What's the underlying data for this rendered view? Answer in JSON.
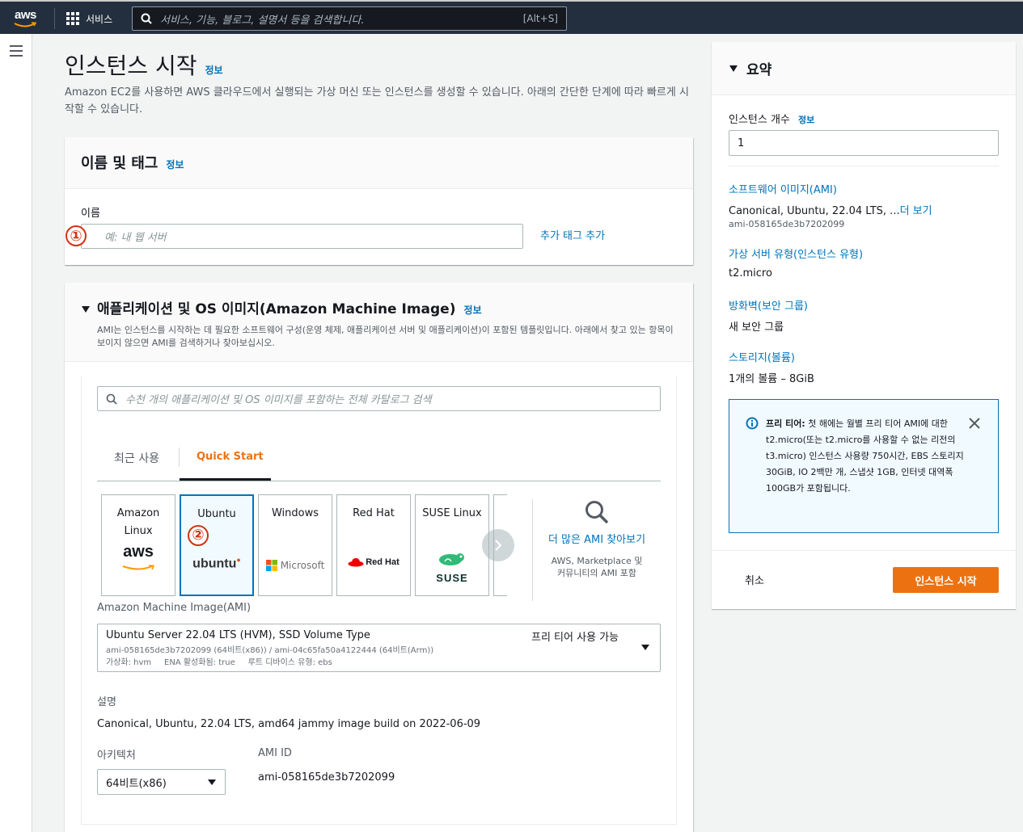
{
  "nav": {
    "logo": "aws",
    "services": "서비스",
    "search_placeholder": "서비스, 기능, 블로그, 설명서 등을 검색합니다.",
    "shortcut": "[Alt+S]"
  },
  "page": {
    "title": "인스턴스 시작",
    "info": "정보",
    "description": "Amazon EC2를 사용하면 AWS 클라우드에서 실행되는 가상 머신 또는 인스턴스를 생성할 수 있습니다. 아래의 간단한 단계에 따라 빠르게 시작할 수 있습니다."
  },
  "name_panel": {
    "title": "이름 및 태그",
    "info": "정보",
    "label": "이름",
    "placeholder": "예: 내 웹 서버",
    "add_tags": "추가 태그 추가",
    "marker": "①"
  },
  "ami_panel": {
    "title": "애플리케이션 및 OS 이미지(Amazon Machine Image)",
    "info": "정보",
    "description": "AMI는 인스턴스를 시작하는 데 필요한 소프트웨어 구성(운영 체제, 애플리케이션 서버 및 애플리케이션)이 포함된 템플릿입니다. 아래에서 찾고 있는 항목이 보이지 않으면 AMI를 검색하거나 찾아보십시오.",
    "search_placeholder": "수천 개의 애플리케이션 및 OS 이미지를 포함하는 전체 카탈로그 검색",
    "tabs": [
      "최근 사용",
      "Quick Start"
    ],
    "tiles": [
      {
        "name1": "Amazon",
        "name2": "Linux",
        "logo": "aws"
      },
      {
        "name1": "Ubuntu",
        "logo": "ubuntu"
      },
      {
        "name1": "Windows",
        "logo": "Microsoft"
      },
      {
        "name1": "Red Hat",
        "logo": "Red Hat"
      },
      {
        "name1": "SUSE Linux",
        "logo": "SUSE"
      }
    ],
    "marker": "②",
    "more_title": "더 많은 AMI 찾아보기",
    "more_sub": "AWS, Marketplace 및 커뮤니티의 AMI 포함",
    "ami_label": "Amazon Machine Image(AMI)",
    "ami_name": "Ubuntu Server 22.04 LTS (HVM), SSD Volume Type",
    "ami_free": "프리 티어 사용 가능",
    "ami_ids": "ami-058165de3b7202099 (64비트(x86)) / ami-04c65fa50a4122444 (64비트(Arm))",
    "ami_meta": "가상화: hvm     ENA 활성화됨: true     루트 디바이스 유형: ebs",
    "desc_label": "설명",
    "desc_value": "Canonical, Ubuntu, 22.04 LTS, amd64 jammy image build on 2022-06-09",
    "arch_label": "아키텍처",
    "arch_value": "64비트(x86)",
    "amiid_label": "AMI ID",
    "amiid_value": "ami-058165de3b7202099"
  },
  "summary": {
    "title": "요약",
    "count_label": "인스턴스 개수",
    "info": "정보",
    "count_value": "1",
    "ami_link": "소프트웨어 이미지(AMI)",
    "ami_value": "Canonical, Ubuntu, 22.04 LTS, ...",
    "ami_more": "더 보기",
    "ami_id": "ami-058165de3b7202099",
    "type_link": "가상 서버 유형(인스턴스 유형)",
    "type_value": "t2.micro",
    "fw_link": "방화벽(보안 그룹)",
    "fw_value": "새 보안 그룹",
    "storage_link": "스토리지(볼륨)",
    "storage_value": "1개의 볼륨 – 8GiB",
    "alert_bold": "프리 티어:",
    "alert_text": " 첫 해에는 월별 프리 티어 AMI에 대한 t2.micro(또는 t2.micro를 사용할 수 없는 리전의 t3.micro) 인스턴스 사용량 750시간, EBS 스토리지 30GiB, IO 2백만 개, 스냅샷 1GB, 인터넷 대역폭 100GB가 포함됩니다.",
    "cancel": "취소",
    "launch": "인스턴스 시작"
  },
  "colors": {
    "nav_bg": "#232f3e",
    "link": "#0073bb",
    "primary": "#ec7211",
    "marker": "#d13212"
  }
}
